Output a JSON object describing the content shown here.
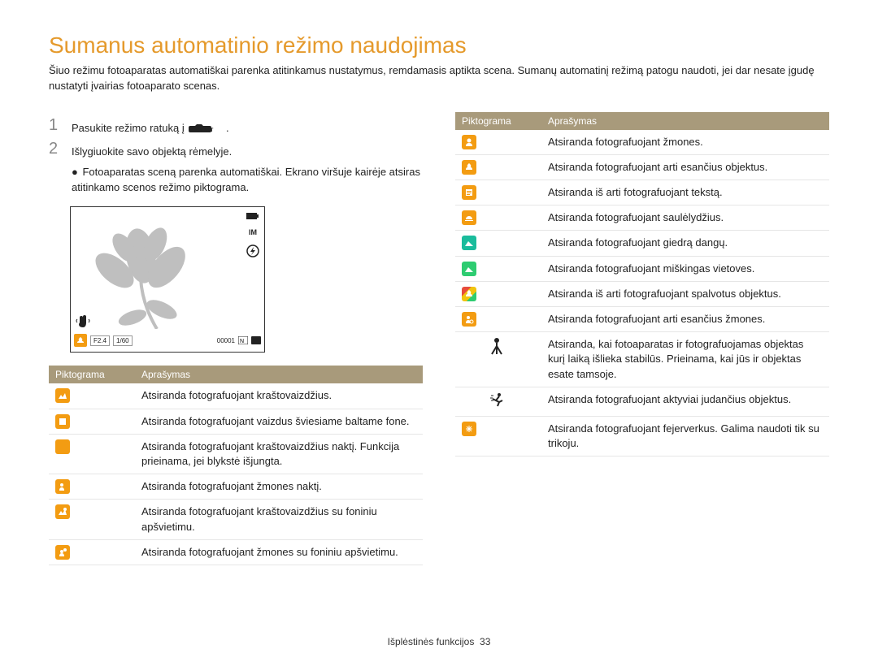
{
  "title": "Sumanus automatinio režimo naudojimas",
  "intro": "Šiuo režimu fotoaparatas automatiškai parenka atitinkamus nustatymus, remdamasis aptikta scena. Sumanų automatinį režimą patogu naudoti, jei dar nesate įgudę nustatyti įvairias fotoaparato scenas.",
  "steps": {
    "s1_num": "1",
    "s1_text_a": "Pasukite režimo ratuką į ",
    "s1_text_b": ".",
    "s2_num": "2",
    "s2_text": "Išlygiuokite savo objektą rėmelyje.",
    "s2_bullet": "Fotoaparatas sceną parenka automatiškai. Ekrano viršuje kairėje atsiras atitinkamo scenos režimo piktograma."
  },
  "lcd": {
    "aperture": "F2.4",
    "shutter": "1/60",
    "counter": "00001",
    "im_label": "IM"
  },
  "table_headers": {
    "icon": "Piktograma",
    "desc": "Aprašymas"
  },
  "left_rows": [
    {
      "desc": "Atsiranda fotografuojant kraštovaizdžius."
    },
    {
      "desc": "Atsiranda fotografuojant vaizdus šviesiame baltame fone."
    },
    {
      "desc": "Atsiranda fotografuojant kraštovaizdžius naktį. Funkcija prieinama, jei blykstė išjungta."
    },
    {
      "desc": "Atsiranda fotografuojant žmones naktį."
    },
    {
      "desc": "Atsiranda fotografuojant kraštovaizdžius su foniniu apšvietimu."
    },
    {
      "desc": "Atsiranda fotografuojant žmones su foniniu apšvietimu."
    }
  ],
  "right_rows": [
    {
      "desc": "Atsiranda fotografuojant žmones."
    },
    {
      "desc": "Atsiranda fotografuojant arti esančius objektus."
    },
    {
      "desc": "Atsiranda iš arti fotografuojant tekstą."
    },
    {
      "desc": "Atsiranda fotografuojant saulėlydžius."
    },
    {
      "desc": "Atsiranda fotografuojant giedrą dangų."
    },
    {
      "desc": "Atsiranda fotografuojant miškingas vietoves."
    },
    {
      "desc": "Atsiranda iš arti fotografuojant spalvotus objektus."
    },
    {
      "desc": "Atsiranda fotografuojant arti esančius žmones."
    },
    {
      "desc": "Atsiranda, kai fotoaparatas ir fotografuojamas objektas kurį laiką išlieka stabilūs. Prieinama, kai jūs ir objektas esate tamsoje."
    },
    {
      "desc": "Atsiranda fotografuojant aktyviai judančius objektus."
    },
    {
      "desc": "Atsiranda fotografuojant fejerverkus. Galima naudoti tik su trikoju."
    }
  ],
  "footer": {
    "section": "Išplėstinės funkcijos",
    "page": "33"
  }
}
